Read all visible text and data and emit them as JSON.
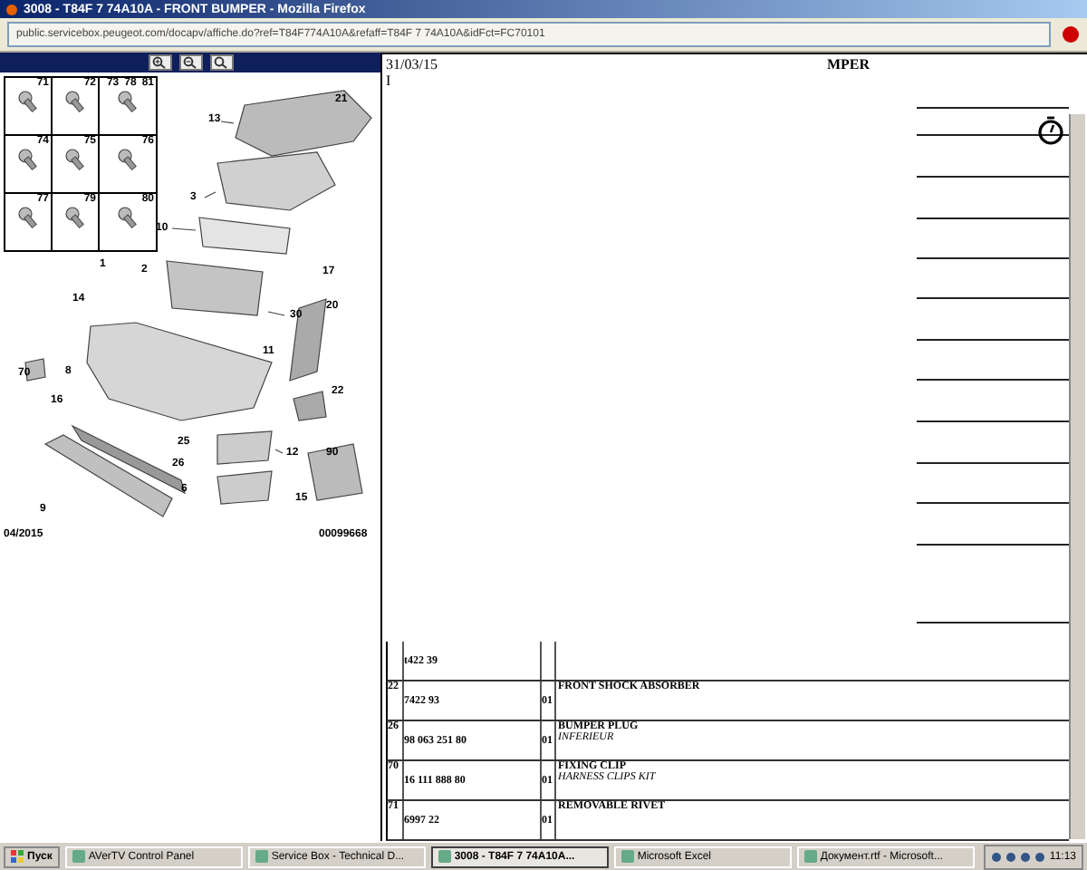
{
  "window": {
    "title": "3008 - T84F 7 74A10A - FRONT BUMPER - Mozilla Firefox"
  },
  "address_bar": {
    "url": "public.servicebox.peugeot.com/docapv/affiche.do?ref=T84F774A10A&refaff=T84F 7 74A10A&idFct=FC70101"
  },
  "toolbar": {
    "buttons": [
      {
        "kind": "zoom-in"
      },
      {
        "kind": "zoom-out"
      },
      {
        "kind": "zoom-fit"
      }
    ]
  },
  "diagram": {
    "insets": [
      {
        "numbers": [
          "71"
        ]
      },
      {
        "numbers": [
          "72"
        ]
      },
      {
        "numbers": [
          "73",
          "78",
          "81"
        ]
      },
      {
        "numbers": [
          "74"
        ]
      },
      {
        "numbers": [
          "75"
        ]
      },
      {
        "numbers": [
          "76"
        ]
      },
      {
        "numbers": [
          "77"
        ]
      },
      {
        "numbers": [
          "79"
        ]
      },
      {
        "numbers": [
          "80"
        ]
      }
    ],
    "callouts": [
      "21",
      "13",
      "3",
      "10",
      "17",
      "2",
      "1",
      "30",
      "20",
      "14",
      "11",
      "70",
      "8",
      "22",
      "16",
      "25",
      "12",
      "26",
      "90",
      "6",
      "15",
      "9"
    ],
    "date": "04/2015",
    "code": "00099668"
  },
  "document": {
    "date": "31/03/15",
    "mark": "I",
    "heading": "MPER",
    "rows": [
      {
        "ref": "",
        "part": "t422 39",
        "qty": "",
        "name": "",
        "note": ""
      },
      {
        "ref": "22",
        "part": "7422 93",
        "qty": "01",
        "name": "FRONT SHOCK ABSORBER",
        "note": ""
      },
      {
        "ref": "26",
        "part": "98 063 251 80",
        "qty": "01",
        "name": "BUMPER PLUG",
        "note": "INFERIEUR"
      },
      {
        "ref": "70",
        "part": "16 111 888 80",
        "qty": "01",
        "name": "FIXING CLIP",
        "note": "HARNESS CLIPS KIT"
      },
      {
        "ref": "71",
        "part": "6997 22",
        "qty": "01",
        "name": "REMOVABLE RIVET",
        "note": ""
      }
    ]
  },
  "taskbar": {
    "start": "Пуск",
    "items": [
      {
        "label": "AVerTV Control Panel",
        "selected": false
      },
      {
        "label": "Service Box - Technical D...",
        "selected": false
      },
      {
        "label": "3008 - T84F 7 74A10A...",
        "selected": true
      },
      {
        "label": "Microsoft Excel",
        "selected": false
      },
      {
        "label": "Документ.rtf - Microsoft...",
        "selected": false
      }
    ],
    "clock": "11:13"
  }
}
